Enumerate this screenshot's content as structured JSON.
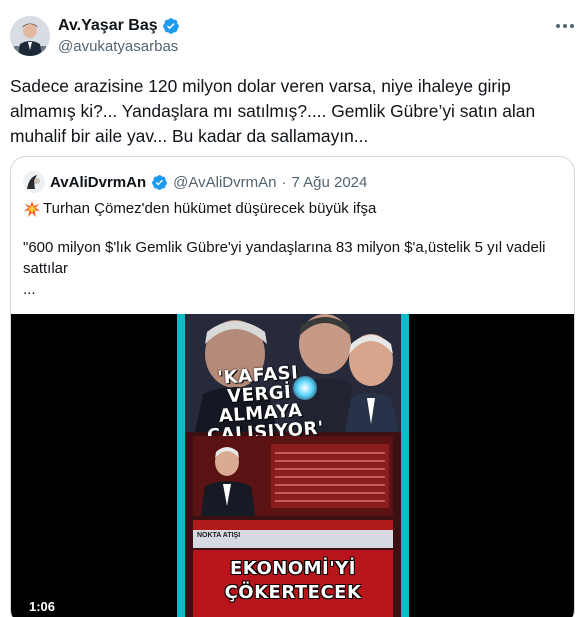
{
  "author": {
    "name": "Av.Yaşar Baş",
    "handle": "@avukatyasarbas",
    "avatar_icon": "profile-photo"
  },
  "tweet": {
    "text": "Sadece arazisine 120 milyon dolar veren varsa, niye ihaleye girip almamış ki?... Yandaşlara mı satılmış?.... Gemlik Gübre’yi satın alan muhalif bir aile yav... Bu kadar da sallamayın..."
  },
  "quoted": {
    "name": "AvAliDvrmAn",
    "handle": "@AvAliDvrmAn",
    "separator": "·",
    "date": "7 Ağu 2024",
    "line1_icon": "collision-emoji",
    "line1": "Turhan Çömez'den hükümet düşürecek büyük ifşa",
    "body": "\"600 milyon $'lık Gemlik Gübre'yi yandaşlarına 83 milyon $'a,üstelik 5 yıl vadeli sattılar\n..."
  },
  "video": {
    "duration": "1:06",
    "headline": [
      "'KAFASI",
      "VERGİ",
      "ALMAYA",
      "ÇALIŞIYOR'"
    ],
    "caption_label": "NOKTA ATIŞI",
    "bottom_line1": "EKONOMİ'Yİ",
    "bottom_line2": "ÇÖKERTECEK"
  },
  "colors": {
    "verified_blue": "#1d9bf0",
    "text": "#0f1419",
    "secondary": "#536471",
    "border": "#cfd9de"
  }
}
